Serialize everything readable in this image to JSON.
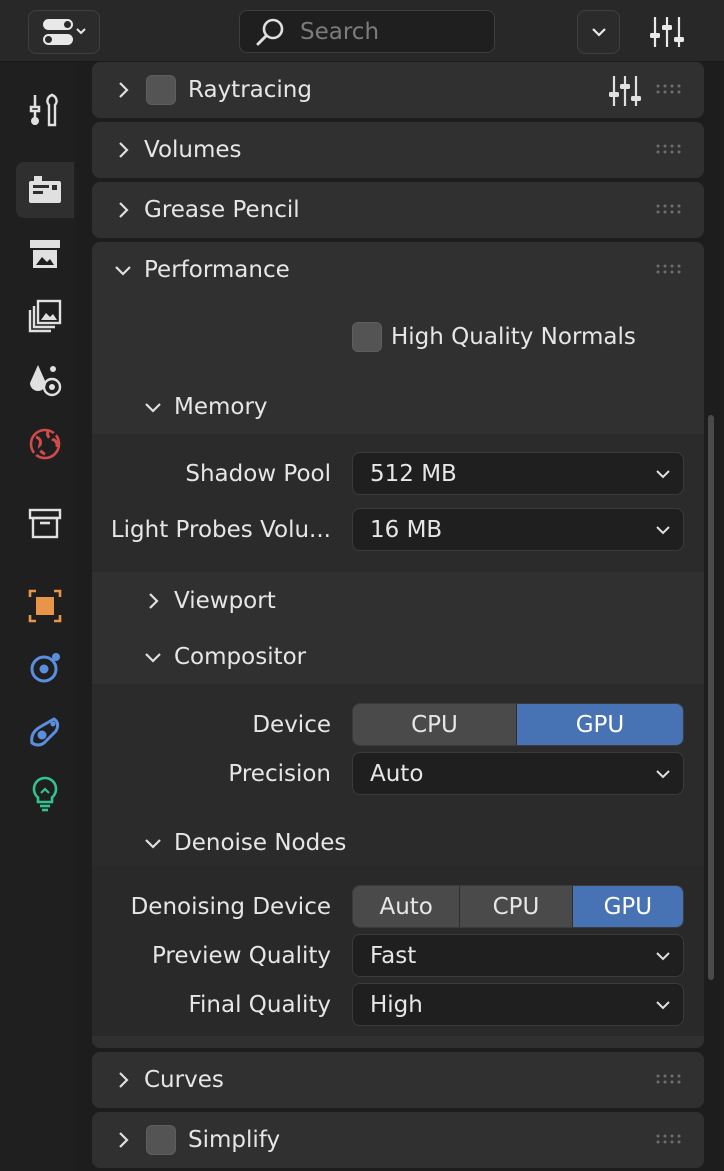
{
  "header": {
    "search_placeholder": "Search"
  },
  "panels": {
    "raytracing": {
      "title": "Raytracing"
    },
    "volumes": {
      "title": "Volumes"
    },
    "grease_pencil": {
      "title": "Grease Pencil"
    },
    "performance": {
      "title": "Performance",
      "high_quality_normals": "High Quality Normals",
      "memory": {
        "title": "Memory",
        "shadow_pool_label": "Shadow Pool",
        "shadow_pool_value": "512 MB",
        "light_probes_label": "Light Probes Volu...",
        "light_probes_value": "16 MB"
      },
      "viewport": {
        "title": "Viewport"
      },
      "compositor": {
        "title": "Compositor",
        "device_label": "Device",
        "device_options": [
          "CPU",
          "GPU"
        ],
        "device_selected": "GPU",
        "precision_label": "Precision",
        "precision_value": "Auto"
      },
      "denoise": {
        "title": "Denoise Nodes",
        "device_label": "Denoising Device",
        "device_options": [
          "Auto",
          "CPU",
          "GPU"
        ],
        "device_selected": "GPU",
        "preview_label": "Preview Quality",
        "preview_value": "Fast",
        "final_label": "Final Quality",
        "final_value": "High"
      }
    },
    "curves": {
      "title": "Curves"
    },
    "simplify": {
      "title": "Simplify"
    }
  },
  "colors": {
    "accent": "#4772b3",
    "panel": "#303030",
    "background": "#1d1d1d"
  }
}
